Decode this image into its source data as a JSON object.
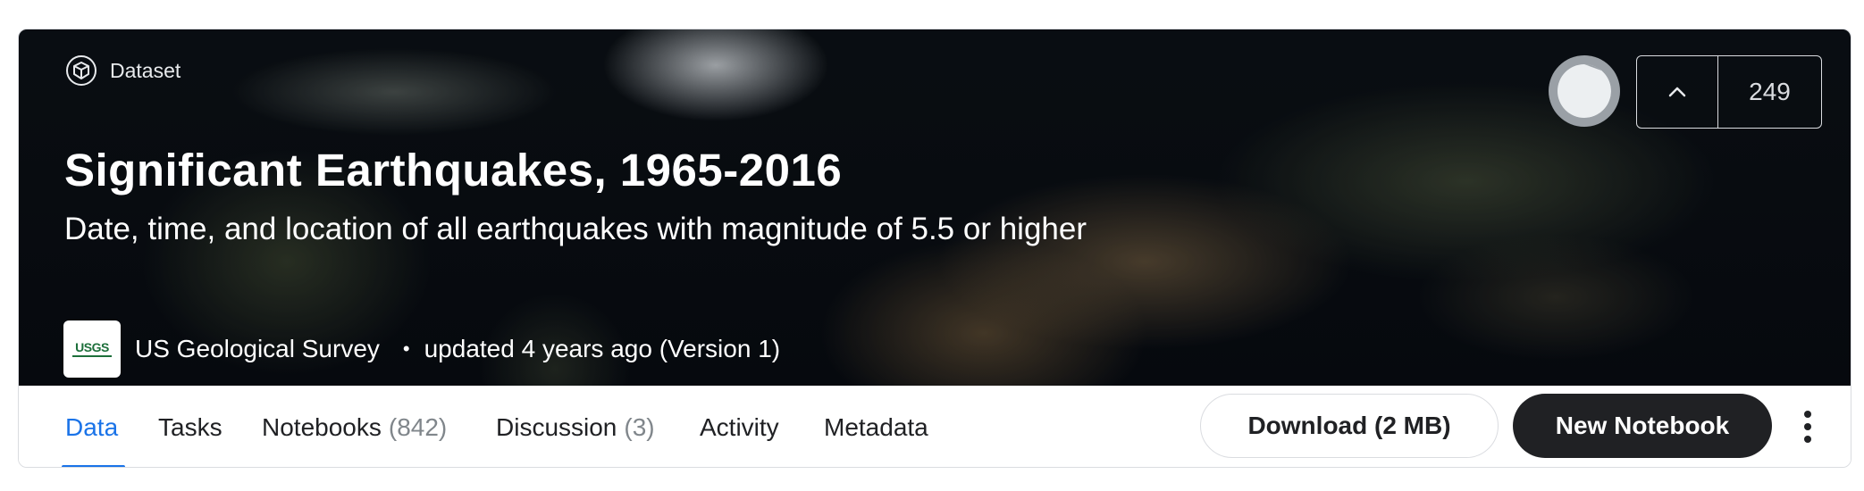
{
  "header": {
    "type_label": "Dataset",
    "title": "Significant Earthquakes, 1965-2016",
    "subtitle": "Date, time, and location of all earthquakes with magnitude of 5.5 or higher",
    "owner": "US Geological Survey",
    "owner_logo_text": "USGS",
    "separator": "•",
    "updated": "updated 4 years ago (Version 1)",
    "upvotes": "249"
  },
  "tabs": [
    {
      "label": "Data",
      "count": ""
    },
    {
      "label": "Tasks",
      "count": ""
    },
    {
      "label": "Notebooks",
      "count": "(842)"
    },
    {
      "label": "Discussion",
      "count": "(3)"
    },
    {
      "label": "Activity",
      "count": ""
    },
    {
      "label": "Metadata",
      "count": ""
    }
  ],
  "active_tab": "Data",
  "actions": {
    "download_label": "Download (2 MB)",
    "new_notebook_label": "New Notebook"
  },
  "icons": {
    "dataset": "dataset-icon",
    "upvote": "chevron-up-icon",
    "more": "more-vertical-icon",
    "usability": "usability-ring-icon"
  },
  "colors": {
    "accent": "#1a73e8",
    "dark_button": "#202124",
    "usgs_green": "#1c6f3a"
  }
}
